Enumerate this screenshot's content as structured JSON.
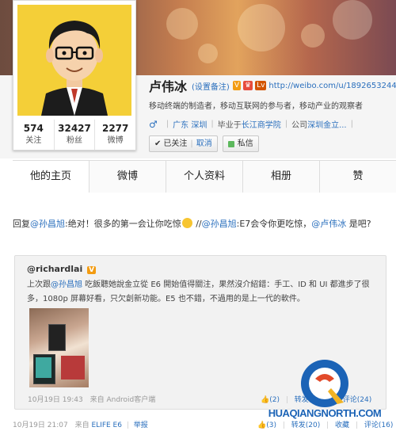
{
  "profile": {
    "name": "卢伟冰",
    "remark": "(设置备注)",
    "badge_v": "V",
    "badge_level": "Lv",
    "url": "http://weibo.com/u/1892653244",
    "bio": "移动终端的制造者，移动互联网的参与者，移动产业的观察者",
    "gender_symbol": "♂",
    "location": "广东 深圳",
    "school_prefix": "毕业于",
    "school": "长江商学院",
    "company_prefix": "公司",
    "company": "深圳金立...",
    "stats": [
      {
        "value": "574",
        "label": "关注"
      },
      {
        "value": "32427",
        "label": "粉丝"
      },
      {
        "value": "2277",
        "label": "微博"
      }
    ],
    "following_label": "已关注",
    "cancel_label": "取消",
    "message_label": "私信"
  },
  "tabs": [
    {
      "label": "他的主页"
    },
    {
      "label": "微博"
    },
    {
      "label": "个人资料"
    },
    {
      "label": "相册"
    },
    {
      "label": "赞"
    }
  ],
  "post": {
    "reply_prefix": "回复",
    "mention1": "@孙昌旭",
    "text1": ":绝对！很多的第一会让你吃惊",
    "repost_sep": " //",
    "mention2": "@孙昌旭",
    "text2": ":E7会令你更吃惊，",
    "mention3": "@卢伟冰",
    "text3": " 是吧?",
    "time": "10月19日 21:07",
    "source_prefix": "来自",
    "source": "ELIFE E6",
    "report": "举报",
    "likes": "(3)",
    "repost": "转发(20)",
    "favorite": "收藏",
    "comment": "评论(16)"
  },
  "repost": {
    "user": "@richardlai",
    "text_prefix": "上次跟",
    "mention": "@孙昌旭",
    "text": " 吃飯聽她說金立從 E6 開始值得關注，果然沒介紹錯：手工、ID 和 UI 都進步了很多，1080p 屏幕好看，只欠創新功能。E5 也不錯，不過用的是上一代的軟件。",
    "time": "10月19日 19:43",
    "source_prefix": "来自",
    "source": "Android客户端",
    "likes": "(2)",
    "repost": "转发(106)",
    "comment": "评论(24)"
  },
  "watermark": {
    "text": "HUAQIANGNORTH.COM"
  },
  "colors": {
    "link": "#2a6fbd",
    "avatar_bg": "#f4cf38",
    "gender": "#2a6fbd"
  }
}
